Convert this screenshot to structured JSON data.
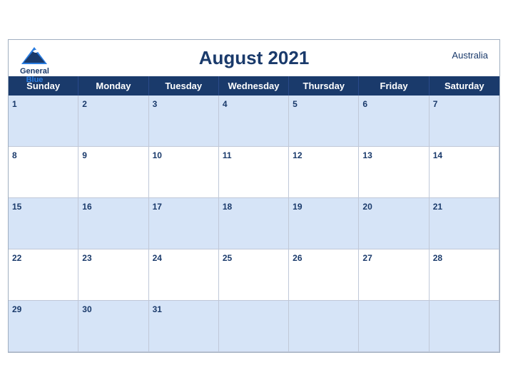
{
  "header": {
    "title": "August 2021",
    "country": "Australia",
    "logo": {
      "line1": "General",
      "line2": "Blue"
    }
  },
  "days": {
    "headers": [
      "Sunday",
      "Monday",
      "Tuesday",
      "Wednesday",
      "Thursday",
      "Friday",
      "Saturday"
    ]
  },
  "weeks": [
    {
      "shaded": true,
      "cells": [
        "1",
        "2",
        "3",
        "4",
        "5",
        "6",
        "7"
      ]
    },
    {
      "shaded": false,
      "cells": [
        "8",
        "9",
        "10",
        "11",
        "12",
        "13",
        "14"
      ]
    },
    {
      "shaded": true,
      "cells": [
        "15",
        "16",
        "17",
        "18",
        "19",
        "20",
        "21"
      ]
    },
    {
      "shaded": false,
      "cells": [
        "22",
        "23",
        "24",
        "25",
        "26",
        "27",
        "28"
      ]
    },
    {
      "shaded": true,
      "cells": [
        "29",
        "30",
        "31",
        "",
        "",
        "",
        ""
      ]
    }
  ]
}
